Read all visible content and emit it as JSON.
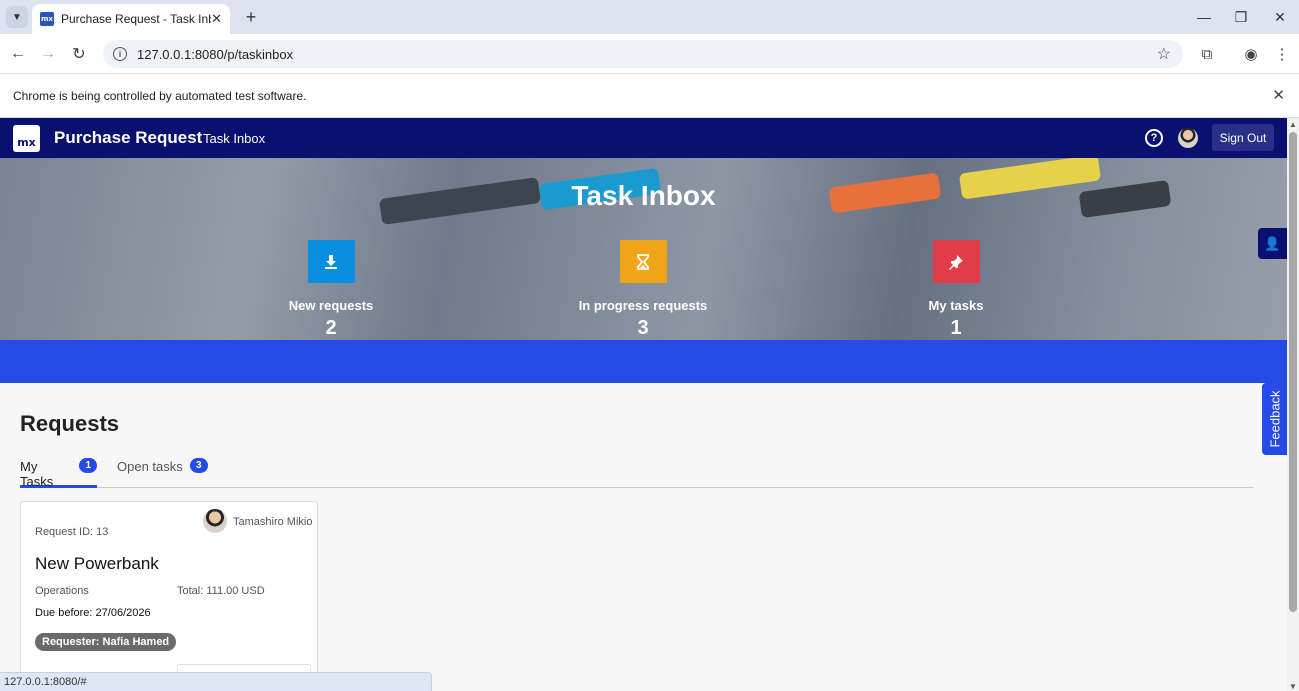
{
  "browser": {
    "tab_title": "Purchase Request - Task Inbox",
    "favicon_text": "mx",
    "url": "127.0.0.1:8080/p/taskinbox",
    "infobar_text": "Chrome is being controlled by automated test software.",
    "status_url": "127.0.0.1:8080/#"
  },
  "header": {
    "logo_text": "mx",
    "app_title": "Purchase Request",
    "subtitle": "Task Inbox",
    "signout_label": "Sign Out"
  },
  "hero": {
    "title": "Task Inbox",
    "stats": [
      {
        "label": "New requests",
        "count": "2",
        "color": "#0a8ee0",
        "icon": "download-icon"
      },
      {
        "label": "In progress requests",
        "count": "3",
        "color": "#f0a418",
        "icon": "hourglass-icon"
      },
      {
        "label": "My tasks",
        "count": "1",
        "color": "#e23b4a",
        "icon": "pin-icon"
      }
    ]
  },
  "requests": {
    "title": "Requests",
    "tabs": [
      {
        "label": "My Tasks",
        "count": "1",
        "active": true
      },
      {
        "label": "Open tasks",
        "count": "3",
        "active": false
      }
    ],
    "card": {
      "person": "Tamashiro Mikio",
      "request_id": "Request ID: 13",
      "title": "New Powerbank",
      "department": "Operations",
      "total": "Total: 111.00 USD",
      "due": "Due before: 27/06/2026",
      "requester": "Requester: Nafia Hamed"
    }
  },
  "feedback_label": "Feedback",
  "colors": {
    "primary": "#264ae5",
    "header": "#0a1070"
  }
}
